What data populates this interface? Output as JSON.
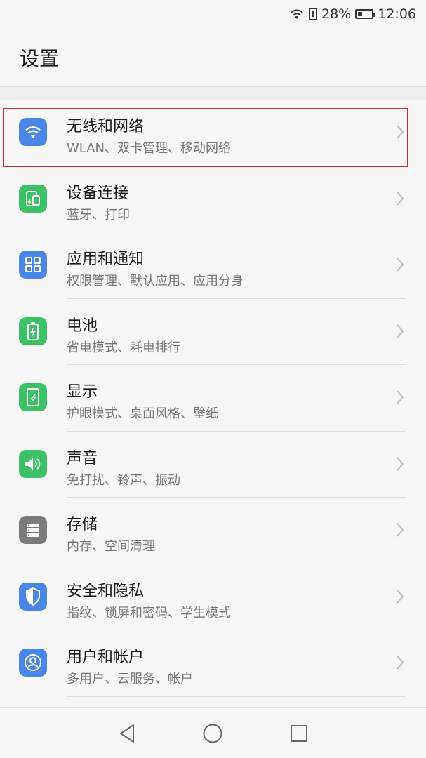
{
  "status_bar": {
    "battery_percent": "28%",
    "time": "12:06",
    "alert_glyph": "!",
    "icons": [
      "wifi-icon",
      "alert-icon",
      "battery-icon"
    ]
  },
  "header": {
    "title": "设置"
  },
  "items": [
    {
      "title": "无线和网络",
      "subtitle": "WLAN、双卡管理、移动网络",
      "icon": "wifi-icon",
      "color": "#4a86e8",
      "highlighted": true
    },
    {
      "title": "设备连接",
      "subtitle": "蓝牙、打印",
      "icon": "device-connect-icon",
      "color": "#3cc167"
    },
    {
      "title": "应用和通知",
      "subtitle": "权限管理、默认应用、应用分身",
      "icon": "apps-grid-icon",
      "color": "#4a86e8"
    },
    {
      "title": "电池",
      "subtitle": "省电模式、耗电排行",
      "icon": "battery-icon",
      "color": "#3cc167"
    },
    {
      "title": "显示",
      "subtitle": "护眼模式、桌面风格、壁纸",
      "icon": "display-icon",
      "color": "#3cc167"
    },
    {
      "title": "声音",
      "subtitle": "免打扰、铃声、振动",
      "icon": "speaker-icon",
      "color": "#3cc167"
    },
    {
      "title": "存储",
      "subtitle": "内存、空间清理",
      "icon": "storage-icon",
      "color": "#7b7b7b"
    },
    {
      "title": "安全和隐私",
      "subtitle": "指纹、锁屏和密码、学生模式",
      "icon": "shield-icon",
      "color": "#4a86e8"
    },
    {
      "title": "用户和帐户",
      "subtitle": "多用户、云服务、帐户",
      "icon": "user-account-icon",
      "color": "#4a86e8"
    }
  ],
  "nav_bar": {
    "icons": [
      "back-icon",
      "home-icon",
      "recents-icon"
    ]
  }
}
